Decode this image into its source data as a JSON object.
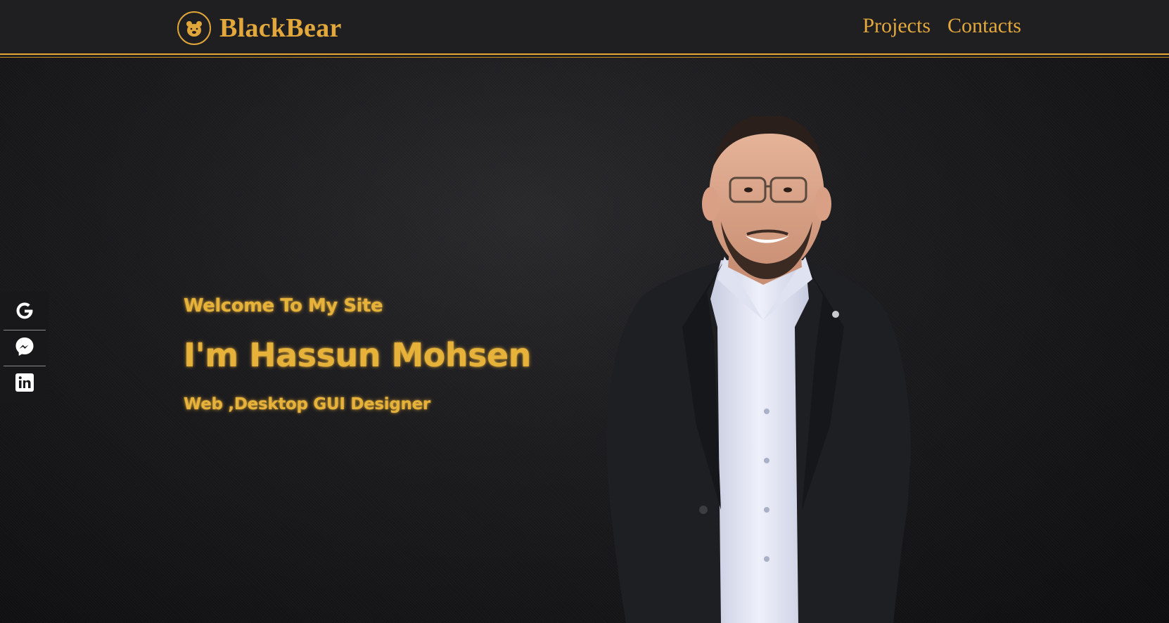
{
  "header": {
    "brand_name": "BlackBear",
    "nav": [
      {
        "label": "Projects"
      },
      {
        "label": "Contacts"
      }
    ]
  },
  "social": [
    {
      "icon": "google-icon"
    },
    {
      "icon": "messenger-icon"
    },
    {
      "icon": "linkedin-icon"
    }
  ],
  "hero": {
    "welcome": "Welcome To My Site",
    "name": "I'm Hassun Mohsen",
    "role": "Web ,Desktop GUI Designer"
  },
  "colors": {
    "accent": "#e2a83c",
    "header_bg": "#1f1f22",
    "page_bg": "#141416"
  }
}
